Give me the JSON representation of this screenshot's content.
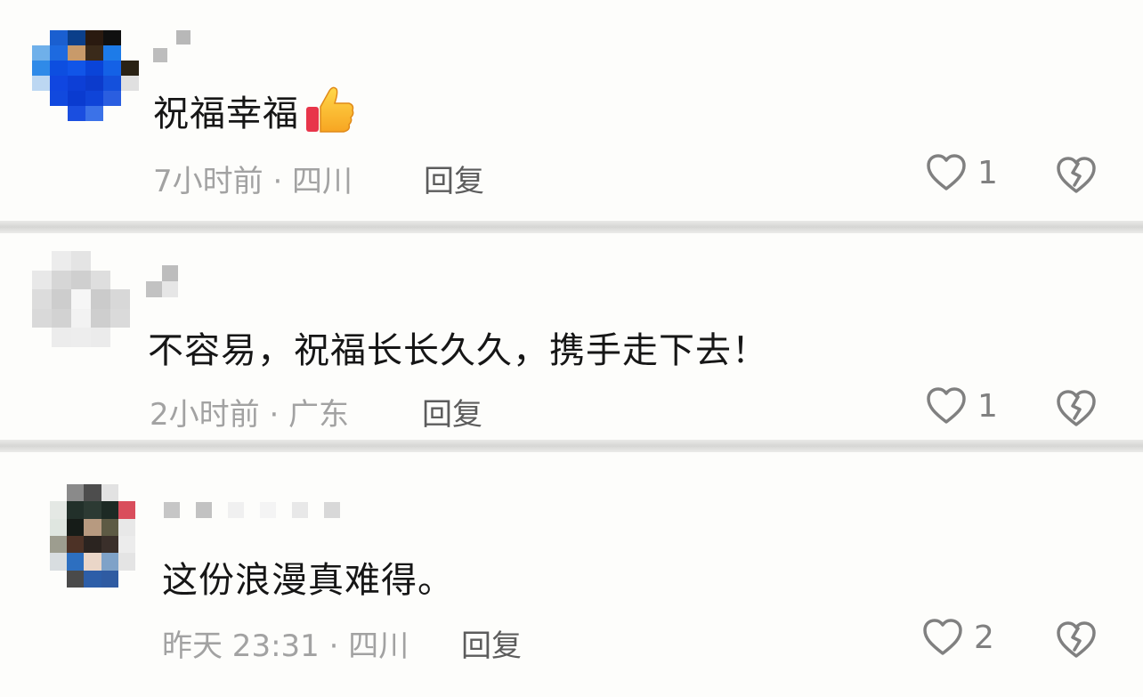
{
  "comments": [
    {
      "text": "祝福幸福",
      "emoji": "thumbs-up-icon",
      "meta": "7小时前 · 四川",
      "reply": "回复",
      "likes": "1"
    },
    {
      "text": "不容易，祝福长长久久，携手走下去！",
      "meta": "2小时前 · 广东",
      "reply": "回复",
      "likes": "1"
    },
    {
      "text": "这份浪漫真难得。",
      "meta": "昨天 23:31 · 四川",
      "reply": "回复",
      "likes": "2"
    }
  ],
  "colors": {
    "background": "#fdfdfb",
    "divider": "#d6d6d4",
    "meta_text": "#a2a2a2",
    "reply_text": "#5c5c5c",
    "icon_gray": "#808080"
  }
}
